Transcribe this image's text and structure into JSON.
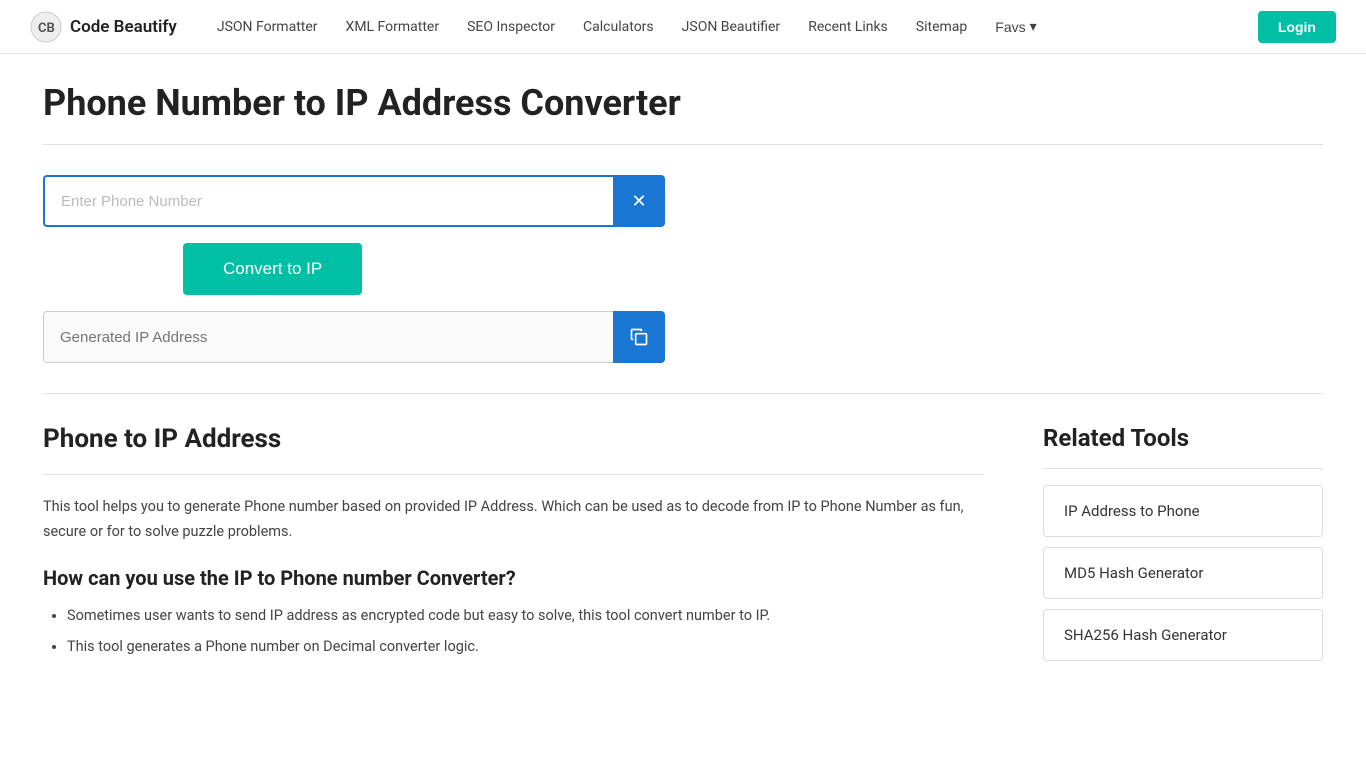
{
  "header": {
    "logo_text": "Code Beautify",
    "nav_items": [
      {
        "label": "JSON Formatter",
        "url": "#"
      },
      {
        "label": "XML Formatter",
        "url": "#"
      },
      {
        "label": "SEO Inspector",
        "url": "#"
      },
      {
        "label": "Calculators",
        "url": "#"
      },
      {
        "label": "JSON Beautifier",
        "url": "#"
      },
      {
        "label": "Recent Links",
        "url": "#"
      },
      {
        "label": "Sitemap",
        "url": "#"
      },
      {
        "label": "Favs",
        "url": "#"
      }
    ],
    "login_label": "Login"
  },
  "page": {
    "title": "Phone Number to IP Address Converter",
    "phone_input_placeholder": "Enter Phone Number",
    "clear_btn_label": "×",
    "convert_btn_label": "Convert to IP",
    "output_placeholder": "Generated IP Address"
  },
  "info": {
    "phone_to_ip_heading": "Phone to IP Address",
    "description": "This tool helps you to generate Phone number based on provided IP Address. Which can be used as to decode from IP to Phone Number as fun, secure or for to solve puzzle problems.",
    "how_to_heading": "How can you use the IP to Phone number Converter?",
    "bullets": [
      "Sometimes user wants to send IP address as encrypted code but easy to solve, this tool convert number to IP.",
      "This tool generates a Phone number on Decimal converter logic."
    ]
  },
  "sidebar": {
    "heading": "Related Tools",
    "tools": [
      {
        "label": "IP Address to Phone"
      },
      {
        "label": "MD5 Hash Generator"
      },
      {
        "label": "SHA256 Hash Generator"
      }
    ]
  }
}
